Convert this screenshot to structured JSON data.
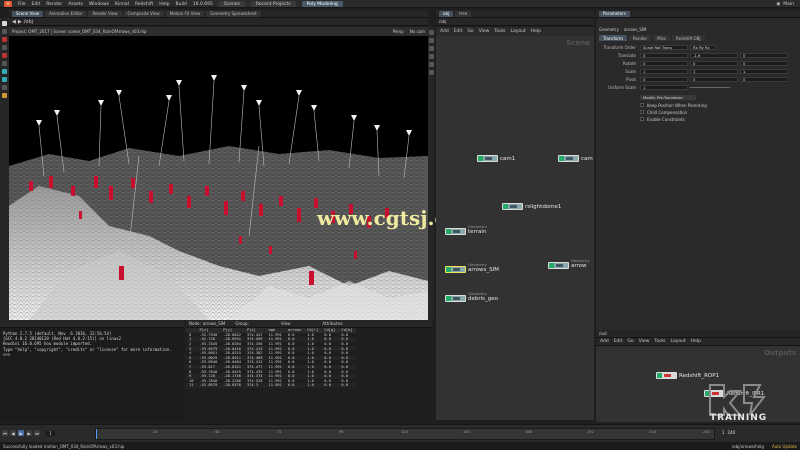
{
  "app": {
    "menus": [
      "File",
      "Edit",
      "Render",
      "Assets",
      "Windows",
      "Kinnal",
      "Redshift",
      "Help"
    ],
    "build_label": "Build",
    "build_version": "16.0.695",
    "desktop_tabs": [
      "Scenes",
      "Recent Projects",
      "Poly Modeling"
    ],
    "active_desktop": "Poly Modeling",
    "user": "Main"
  },
  "viewport": {
    "tabs": [
      "Scene View",
      "Animation Editor",
      "Render View",
      "Composite View",
      "Motion FX View",
      "Geometry Spreadsheet"
    ],
    "path_label": "/obj",
    "view_mode": "Persp",
    "camera": "No cam",
    "project_text": "Project: OMT_2017 | Scene: scene_OMT_034_RainOfArrows_v03.hip",
    "fps": "86fps"
  },
  "watermark": "www.cgtsj.com",
  "console": {
    "lines": [
      "Python 2.7.5 (default, Nov  6 2016, 12:56:54)",
      "[GCC 4.8.2 20140120 (Red Hat 4.8.2-15)] on linux2",
      "Houdini 16.0.695 hou module imported.",
      "Type \"help\", \"copyright\", \"credits\" or \"license\" for more information.",
      ">>>"
    ]
  },
  "spreadsheet": {
    "node_label": "Node:",
    "node_value": "arrows_SIM",
    "group_label": "Group:",
    "view_label": "View",
    "attributes_label": "Attributes:",
    "columns": [
      "",
      "P[x]",
      "P[y]",
      "P[z]",
      "age",
      "arrows",
      "Cd[r]",
      "Cd[g]",
      "Cd[b]"
    ],
    "rows": [
      [
        "0",
        "-92.7940",
        "-28.8022",
        "374.447",
        "11.991",
        "0.0",
        "1.0",
        "0.0",
        "0.0"
      ],
      [
        "1",
        "-92.728",
        "-28.0931",
        "374.509",
        "11.991",
        "0.0",
        "1.0",
        "0.0",
        "0.0"
      ],
      [
        "2",
        "-93.7845",
        "-28.8284",
        "374.356",
        "11.991",
        "0.0",
        "1.0",
        "0.0",
        "0.0"
      ],
      [
        "3",
        "-93.0579",
        "-28.0416",
        "374.413",
        "11.991",
        "0.0",
        "1.0",
        "0.0",
        "0.0"
      ],
      [
        "4",
        "-93.0051",
        "-28.0215",
        "374.382",
        "11.991",
        "0.0",
        "1.0",
        "0.0",
        "0.0"
      ],
      [
        "5",
        "-93.0029",
        "-28.8911",
        "374.469",
        "11.991",
        "0.0",
        "1.0",
        "0.0",
        "0.0"
      ],
      [
        "6",
        "-93.0940",
        "-28.0484",
        "374.412",
        "11.991",
        "0.0",
        "1.0",
        "0.0",
        "0.0"
      ],
      [
        "7",
        "-93.817",
        "-28.0321",
        "374.477",
        "11.991",
        "0.0",
        "1.0",
        "0.0",
        "0.0"
      ],
      [
        "8",
        "-93.7840",
        "-28.0425",
        "374.435",
        "11.991",
        "0.0",
        "1.0",
        "0.0",
        "0.0"
      ],
      [
        "9",
        "-93.728",
        "-28.1746",
        "374.374",
        "11.991",
        "0.0",
        "1.0",
        "0.0",
        "0.0"
      ],
      [
        "10",
        "-93.7840",
        "-28.2286",
        "374.528",
        "11.991",
        "0.0",
        "1.0",
        "0.0",
        "0.0"
      ],
      [
        "11",
        "-92.8579",
        "-28.8576",
        "374.3",
        "11.991",
        "0.0",
        "1.0",
        "0.0",
        "0.0"
      ]
    ]
  },
  "network": {
    "path": "/obj",
    "menus": [
      "Add",
      "Edit",
      "Go",
      "View",
      "Tools",
      "Layout",
      "Help"
    ],
    "context_title": "Scene",
    "nodes": [
      {
        "name": "cam1",
        "type": ""
      },
      {
        "name": "cam",
        "type": ""
      },
      {
        "name": "rslightdome1",
        "type": ""
      },
      {
        "name": "terrain",
        "type": "Geometry"
      },
      {
        "name": "arrows_SIM",
        "type": "Geometry"
      },
      {
        "name": "arrow",
        "type": "Geometry"
      },
      {
        "name": "debris_geo",
        "type": "Geometry"
      }
    ]
  },
  "params": {
    "node_type": "Geometry",
    "node_name": "arrows_SIM",
    "tabs": [
      "Transform",
      "Render",
      "Misc",
      "Redshift OBJ"
    ],
    "transform_order_label": "Transform Order",
    "transform_order_value": "Scale Rot Trans",
    "rotate_order_value": "Rx Ry Rz",
    "rows": [
      {
        "label": "Translate",
        "values": [
          "0",
          "-1.9",
          "0"
        ]
      },
      {
        "label": "Rotate",
        "values": [
          "0",
          "0",
          "0"
        ]
      },
      {
        "label": "Scale",
        "values": [
          "1",
          "1",
          "1"
        ]
      },
      {
        "label": "Pivot",
        "values": [
          "0",
          "0",
          "0"
        ]
      },
      {
        "label": "Uniform Scale",
        "values": [
          "1"
        ]
      }
    ],
    "modify_button": "Modify Pre-Transform",
    "checkboxes": [
      "Keep Position When Parenting",
      "Child Compensation",
      "Enable Constraints"
    ]
  },
  "outputs": {
    "path": "/out",
    "menus": [
      "Add",
      "Edit",
      "Go",
      "View",
      "Tools",
      "Layout",
      "Help"
    ],
    "context_title": "Outputs",
    "nodes": [
      "Redshift_ROP1",
      "Redshift_IPR1"
    ]
  },
  "timeline": {
    "start": "1",
    "current": "1",
    "end": "240",
    "ticks": [
      "24",
      "48",
      "72",
      "96",
      "120",
      "144",
      "168",
      "192",
      "216",
      "240"
    ]
  },
  "status": {
    "message": "Successfully loaded motion_OMT_034_RainOfArrows_v03.hip",
    "path": "/obj/arrows/heig",
    "update": "Auto Update"
  },
  "brand": "TRAINING",
  "colors": {
    "accent": "#e0582a",
    "node_sel": "#f2e45a",
    "arrow_red": "#c8102e"
  }
}
